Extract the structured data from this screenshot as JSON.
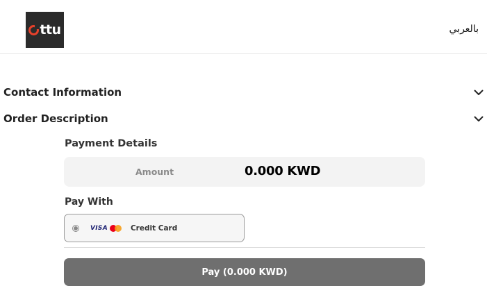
{
  "header": {
    "logo_text": "ttu",
    "logo_accent_color": "#e8412b",
    "language_toggle": "بالعربي"
  },
  "sections": [
    {
      "title": "Contact Information",
      "icon": "chevron-down-icon"
    },
    {
      "title": "Order Description",
      "icon": "chevron-down-icon"
    }
  ],
  "payment_details": {
    "title": "Payment Details",
    "amount_label": "Amount",
    "amount_value": "0.000 KWD"
  },
  "pay_with": {
    "title": "Pay With",
    "methods": [
      {
        "label": "Credit Card",
        "brands": [
          "VISA",
          "mastercard"
        ],
        "selected": true
      }
    ]
  },
  "pay_button": {
    "label": "Pay (0.000 KWD)",
    "color": "#6f6f6f"
  }
}
